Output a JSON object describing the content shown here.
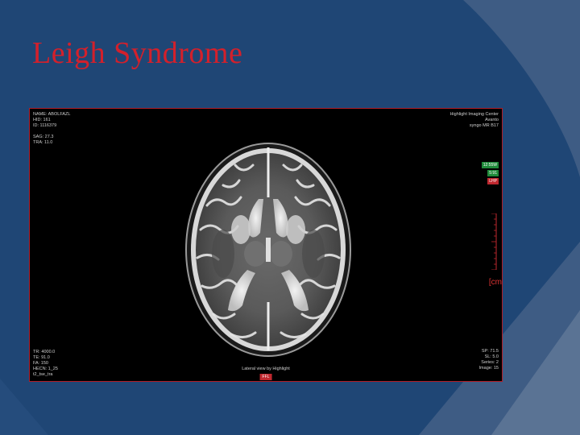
{
  "slide": {
    "title": "Leigh Syndrome"
  },
  "colors": {
    "background": "#1f4675",
    "title": "#d3202b",
    "frame_border": "#b01e28",
    "shape_light": "#3e5c84",
    "shape_lighter": "#5a7394"
  },
  "overlay": {
    "top_left": [
      "NAME: ABOLFAZL",
      "HID: 161",
      "ID: 1116379",
      "",
      "SAG: 27.3",
      "TRA: 11.0"
    ],
    "top_right": [
      "Highlight Imaging Center",
      "Avanto",
      "syngo MR B17"
    ],
    "tags": [
      {
        "text": "12:55W",
        "color": "#1f8a3a"
      },
      {
        "text": "5:91",
        "color": "#1f8a3a"
      },
      {
        "text": "LHP",
        "color": "#c0282f"
      }
    ],
    "unit_label": "[cm",
    "bottom_left": [
      "TR: 4000.0",
      "TE: 91.0",
      "FA: 150",
      "HECN: 1_25",
      "t2_tse_tra"
    ],
    "bottom_right": [
      "SP: 71.5",
      "SL: 5.0",
      "Series: 2",
      "Image: 15"
    ],
    "bottom_center": "Lateral view by Highlight",
    "bottom_tag": "FFL"
  }
}
